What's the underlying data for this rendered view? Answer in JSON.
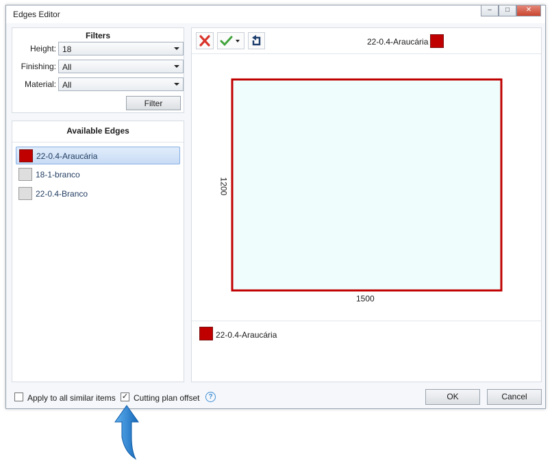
{
  "window": {
    "title": "Edges Editor",
    "min_icon": "minimize-icon",
    "max_icon": "maximize-icon",
    "close_icon": "close-icon"
  },
  "filters": {
    "title": "Filters",
    "height_label": "Height:",
    "height_value": "18",
    "finishing_label": "Finishing:",
    "finishing_value": "All",
    "material_label": "Material:",
    "material_value": "All",
    "filter_button": "Filter"
  },
  "available": {
    "title": "Available Edges",
    "items": [
      {
        "label": "22-0.4-Araucária",
        "color": "#c00000",
        "selected": true
      },
      {
        "label": "18-1-branco",
        "color": "#dedede",
        "selected": false
      },
      {
        "label": "22-0.4-Branco",
        "color": "#dedede",
        "selected": false
      }
    ]
  },
  "toolbar": {
    "current_edge": "22-0.4-Araucária",
    "current_color": "#c00000",
    "remove_icon": "red-x-icon",
    "apply_icon": "green-check-icon",
    "rotate_icon": "rotate-icon"
  },
  "preview": {
    "width_label": "1500",
    "height_label": "1200",
    "fill": "#effdfd",
    "edge_color": "#c00000"
  },
  "legend": {
    "label": "22-0.4-Araucária",
    "color": "#c00000"
  },
  "bottom": {
    "apply_all_label": "Apply to all similar items",
    "apply_all_checked": false,
    "cutting_label": "Cutting plan offset",
    "cutting_checked": true,
    "help_icon": "help-icon",
    "ok": "OK",
    "cancel": "Cancel"
  },
  "annotation": {
    "arrow_icon": "blue-arrow-up-icon",
    "arrow_color": "#1f7fd6"
  }
}
